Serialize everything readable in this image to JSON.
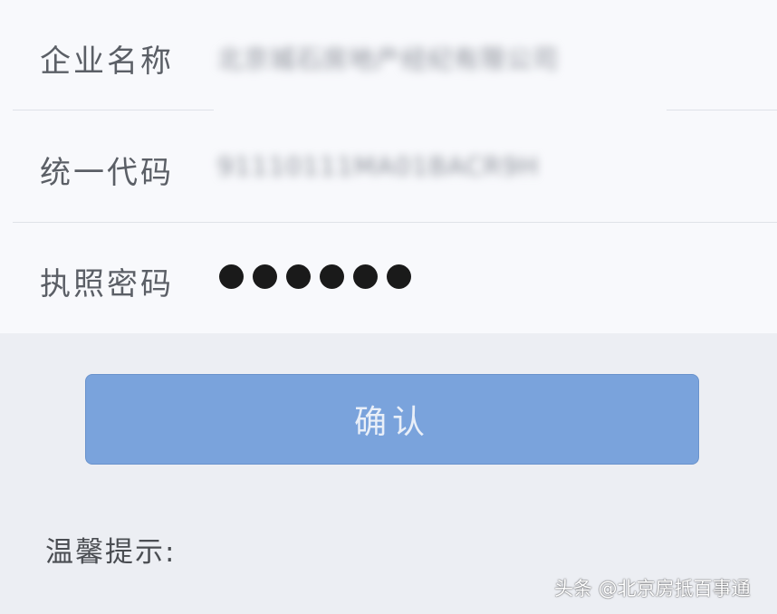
{
  "form": {
    "company_name": {
      "label": "企业名称",
      "value": "北京城石房地产经纪有限公司"
    },
    "unified_code": {
      "label": "统一代码",
      "value": "91110111MA01BACR9H"
    },
    "license_password": {
      "label": "执照密码",
      "value": "●●●●●●"
    }
  },
  "confirm_button": {
    "label": "确认"
  },
  "tip": {
    "label": "温馨提示:"
  },
  "watermark": {
    "text": "头条 @北京房抵百事通"
  },
  "colors": {
    "button_bg": "#7aa3dc",
    "button_text": "#e9eff8",
    "form_bg": "#f8f9fc",
    "page_bg": "#eceef3"
  }
}
